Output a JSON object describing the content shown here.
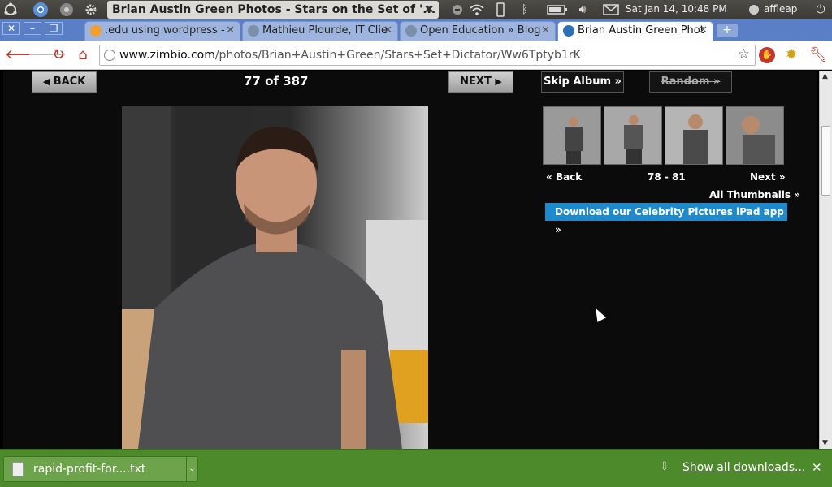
{
  "panel": {
    "window_title": "Brian Austin Green Photos - Stars on the Set of '...",
    "datetime": "Sat Jan 14, 10:48 PM",
    "user": "affleap"
  },
  "tabs": [
    {
      "label": ".edu using wordpress -",
      "favicon_color": "#f0a030",
      "active": false
    },
    {
      "label": "Mathieu Plourde, IT Clie",
      "favicon_color": "#7b8fa8",
      "active": false
    },
    {
      "label": "Open Education » Blog",
      "favicon_color": "#7b8fa8",
      "active": false
    },
    {
      "label": "Brian Austin Green Phot",
      "favicon_color": "#2c6fb5",
      "active": true
    }
  ],
  "toolbar": {
    "url_domain": "www.zimbio.com",
    "url_path": "/photos/Brian+Austin+Green/Stars+Set+Dictator/Ww6Tptyb1rK"
  },
  "gallery": {
    "back_label": "BACK",
    "next_label": "NEXT",
    "current": "77",
    "of_label": "of",
    "total": "387",
    "skip_album_label": "Skip Album »",
    "random_label": "Random »",
    "thumb_back_label": "Back",
    "thumb_range": "78 - 81",
    "thumb_next_label": "Next",
    "all_thumbnails_label": "All Thumbnails »",
    "ipad_app_label": "Download our Celebrity Pictures iPad app »"
  },
  "downloads": {
    "file_label": "rapid-profit-for....txt",
    "show_all_label": "Show all downloads..."
  },
  "colors": {
    "tab_strip": "#5a7fc6",
    "ipad_banner": "#1f8acb",
    "download_shelf": "#4c8a2b"
  }
}
